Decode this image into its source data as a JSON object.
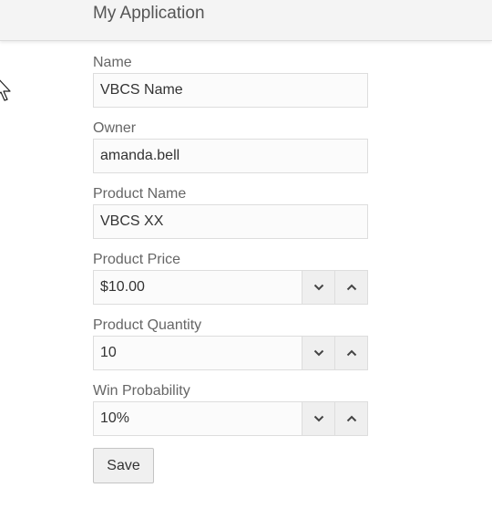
{
  "header": {
    "title": "My Application"
  },
  "form": {
    "name": {
      "label": "Name",
      "value": "VBCS Name"
    },
    "owner": {
      "label": "Owner",
      "value": "amanda.bell"
    },
    "product_name": {
      "label": "Product Name",
      "value": "VBCS XX"
    },
    "product_price": {
      "label": "Product Price",
      "value": "$10.00"
    },
    "product_quantity": {
      "label": "Product Quantity",
      "value": "10"
    },
    "win_probability": {
      "label": "Win Probability",
      "value": "10%"
    },
    "save_label": "Save"
  },
  "icons": {
    "decrement": "chevron-down-icon",
    "increment": "chevron-up-icon",
    "cursor": "mouse-pointer-icon"
  },
  "colors": {
    "header_bg": "#f4f4f4",
    "input_border": "#dddddd",
    "spin_button_bg": "#efefef"
  }
}
